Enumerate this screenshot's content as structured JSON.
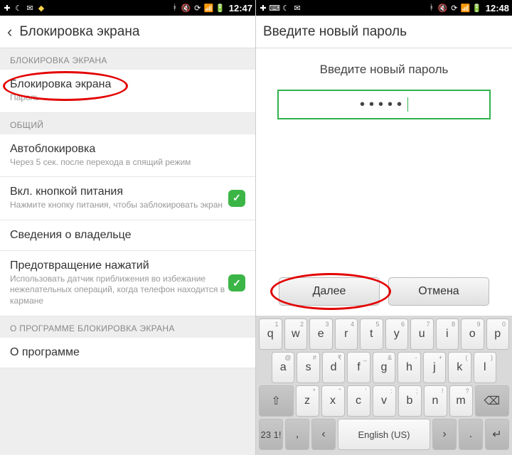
{
  "statusbar": {
    "time_left": "12:47",
    "time_right": "12:48"
  },
  "left": {
    "title": "Блокировка экрана",
    "sections": {
      "lock": "БЛОКИРОВКА ЭКРАНА",
      "general": "ОБЩИЙ",
      "about": "О ПРОГРАММЕ БЛОКИРОВКА ЭКРАНА"
    },
    "rows": {
      "screenlock": {
        "title": "Блокировка экрана",
        "sub": "Пароль"
      },
      "autolock": {
        "title": "Автоблокировка",
        "sub": "Через 5 сек. после перехода в спящий режим"
      },
      "powerbtn": {
        "title": "Вкл. кнопкой питания",
        "sub": "Нажмите кнопку питания, чтобы заблокировать экран"
      },
      "owner": {
        "title": "Сведения о владельце"
      },
      "prevent": {
        "title": "Предотвращение нажатий",
        "sub": "Использовать датчик приближения во избежание нежелательных операций, когда телефон находится в кармане"
      },
      "about": {
        "title": "О программе"
      }
    }
  },
  "right": {
    "title": "Введите новый пароль",
    "prompt": "Введите новый пароль",
    "password_mask": "•••••",
    "btn_next": "Далее",
    "btn_cancel": "Отмена"
  },
  "keyboard": {
    "row1": [
      {
        "k": "q",
        "n": "1"
      },
      {
        "k": "w",
        "n": "2"
      },
      {
        "k": "e",
        "n": "3"
      },
      {
        "k": "r",
        "n": "4"
      },
      {
        "k": "t",
        "n": "5"
      },
      {
        "k": "y",
        "n": "6"
      },
      {
        "k": "u",
        "n": "7"
      },
      {
        "k": "i",
        "n": "8"
      },
      {
        "k": "o",
        "n": "9"
      },
      {
        "k": "p",
        "n": "0"
      }
    ],
    "row2": [
      {
        "k": "a",
        "n": "@"
      },
      {
        "k": "s",
        "n": "#"
      },
      {
        "k": "d",
        "n": "₹"
      },
      {
        "k": "f",
        "n": "_"
      },
      {
        "k": "g",
        "n": "&"
      },
      {
        "k": "h",
        "n": "-"
      },
      {
        "k": "j",
        "n": "+"
      },
      {
        "k": "k",
        "n": "("
      },
      {
        "k": "l",
        "n": ")"
      }
    ],
    "row3": [
      {
        "k": "z",
        "n": "*"
      },
      {
        "k": "x",
        "n": "\""
      },
      {
        "k": "c",
        "n": "'"
      },
      {
        "k": "v",
        "n": ":"
      },
      {
        "k": "b",
        "n": ";"
      },
      {
        "k": "n",
        "n": "!"
      },
      {
        "k": "m",
        "n": "?"
      }
    ],
    "shift": "⇧",
    "backspace": "⌫",
    "sym": "23\n1!",
    "comma": ",",
    "lang_left": "‹",
    "space": "English (US)",
    "lang_right": "›",
    "period": ".",
    "enter": "↵"
  }
}
